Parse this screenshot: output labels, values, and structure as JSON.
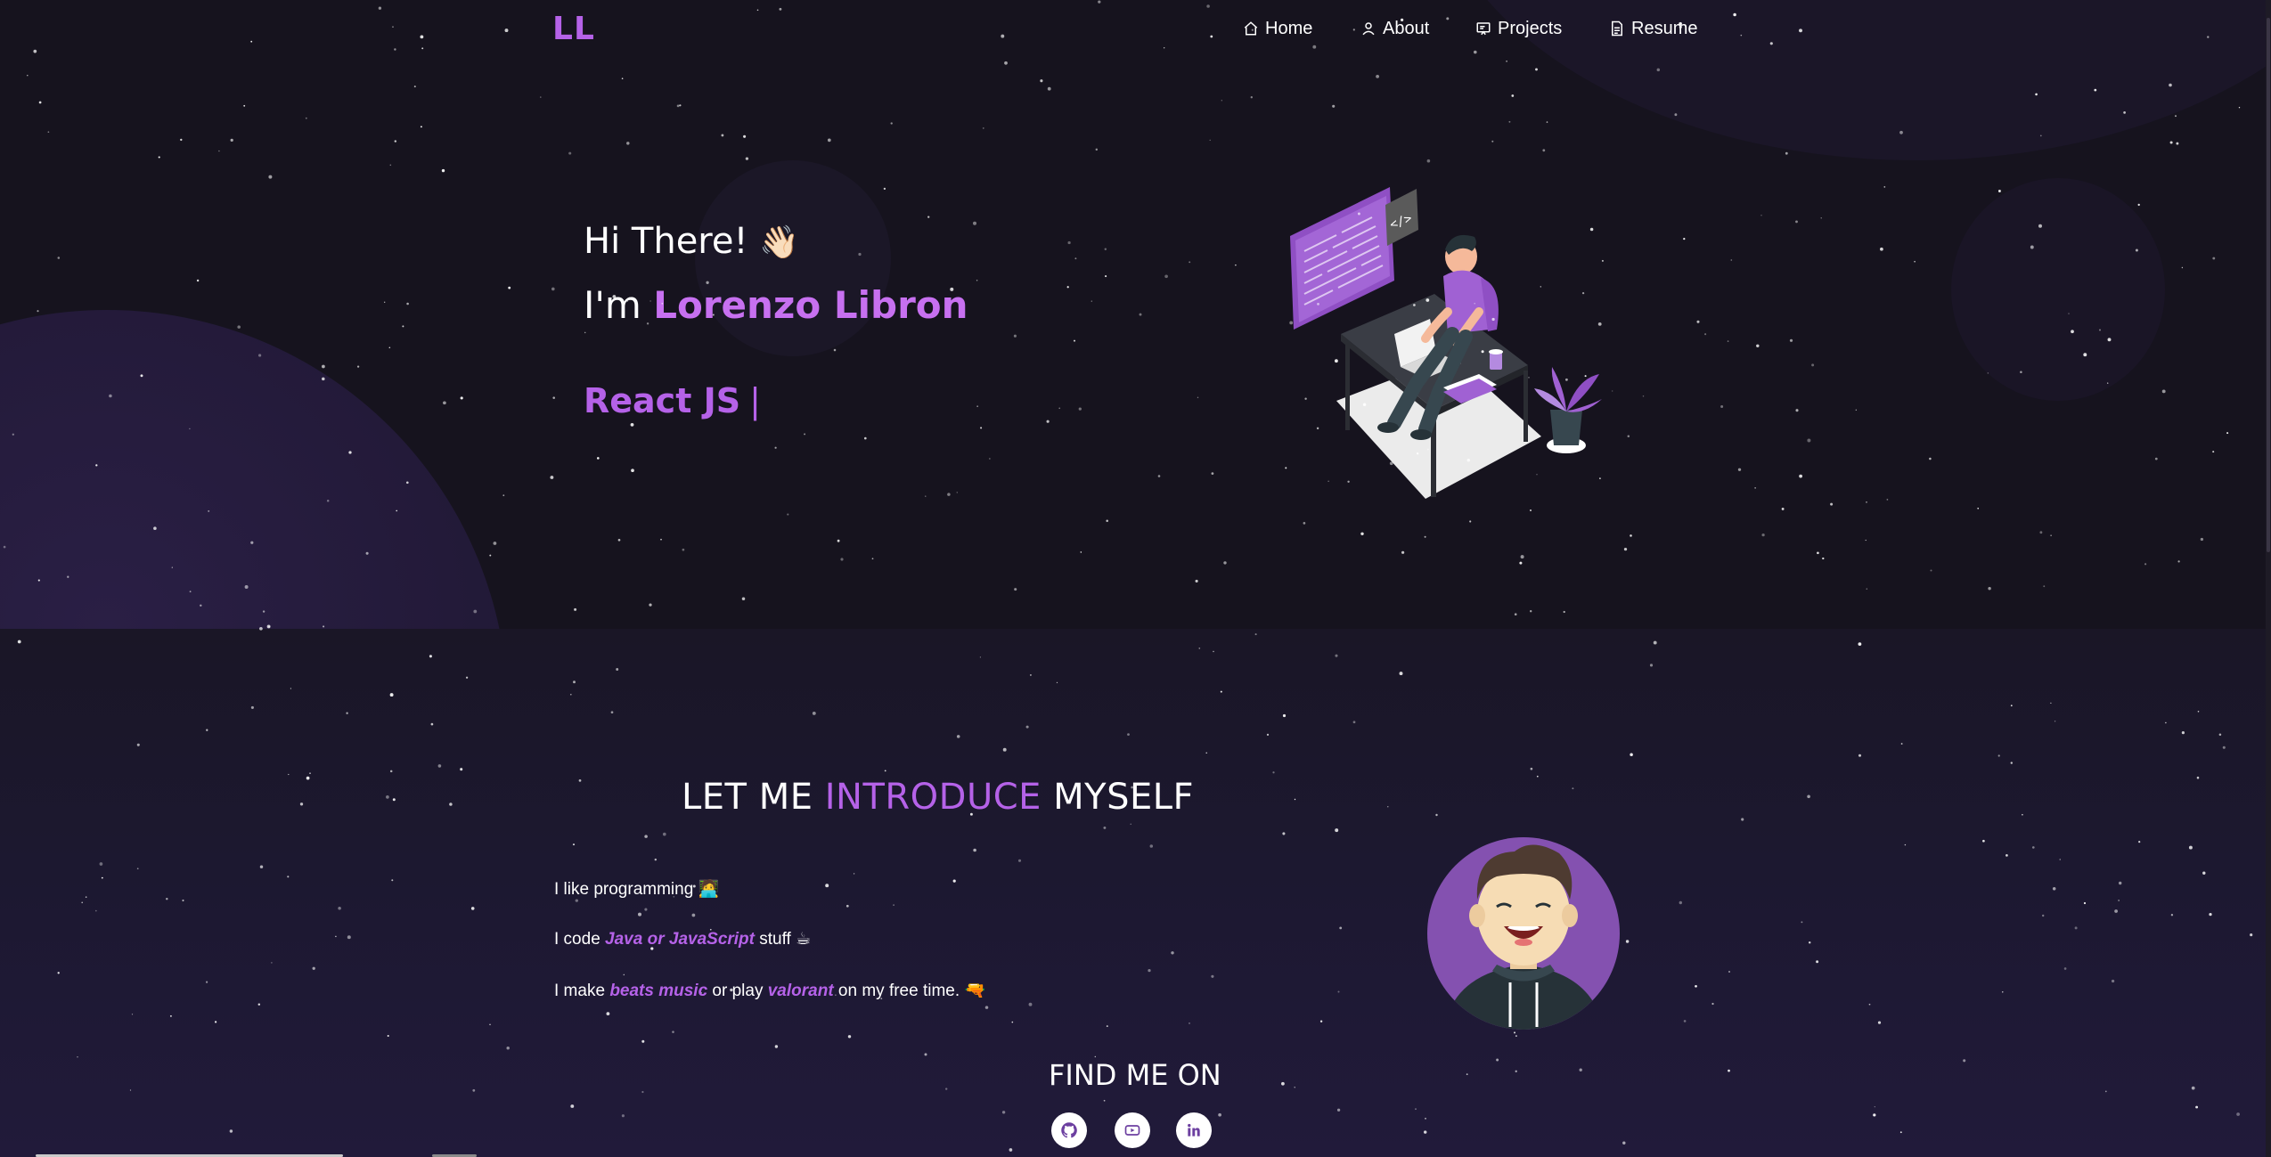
{
  "navbar": {
    "logo": "LL",
    "items": [
      {
        "label": "Home",
        "icon": "home-icon"
      },
      {
        "label": "About",
        "icon": "user-icon"
      },
      {
        "label": "Projects",
        "icon": "projects-icon"
      },
      {
        "label": "Resume",
        "icon": "document-icon"
      }
    ]
  },
  "hero": {
    "greeting": "Hi There!",
    "greeting_emoji": "👋🏻",
    "name_prefix": "I'm ",
    "name": "Lorenzo Libron",
    "typed_text": "React JS",
    "typed_cursor": "|"
  },
  "about": {
    "title_part1": "LET ME ",
    "title_highlight": "INTRODUCE",
    "title_part2": " MYSELF",
    "line1_text": "I like programming",
    "line1_emoji": "🧑‍💻",
    "line2_prefix": "I code ",
    "line2_highlight": "Java or JavaScript",
    "line2_suffix": " stuff",
    "line2_emoji": "☕",
    "line3_prefix": "I make ",
    "line3_highlight1": "beats music",
    "line3_middle": " or play ",
    "line3_highlight2": "valorant",
    "line3_suffix": " on my free time.",
    "line3_emoji": "🔫"
  },
  "find_me": {
    "title": "FIND ME ON",
    "socials": [
      {
        "name": "github",
        "icon": "github-icon"
      },
      {
        "name": "youtube",
        "icon": "youtube-icon"
      },
      {
        "name": "linkedin",
        "icon": "linkedin-icon"
      }
    ]
  },
  "colors": {
    "accent": "#b562e8",
    "accent_light": "#c770f0",
    "background": "#121019"
  }
}
